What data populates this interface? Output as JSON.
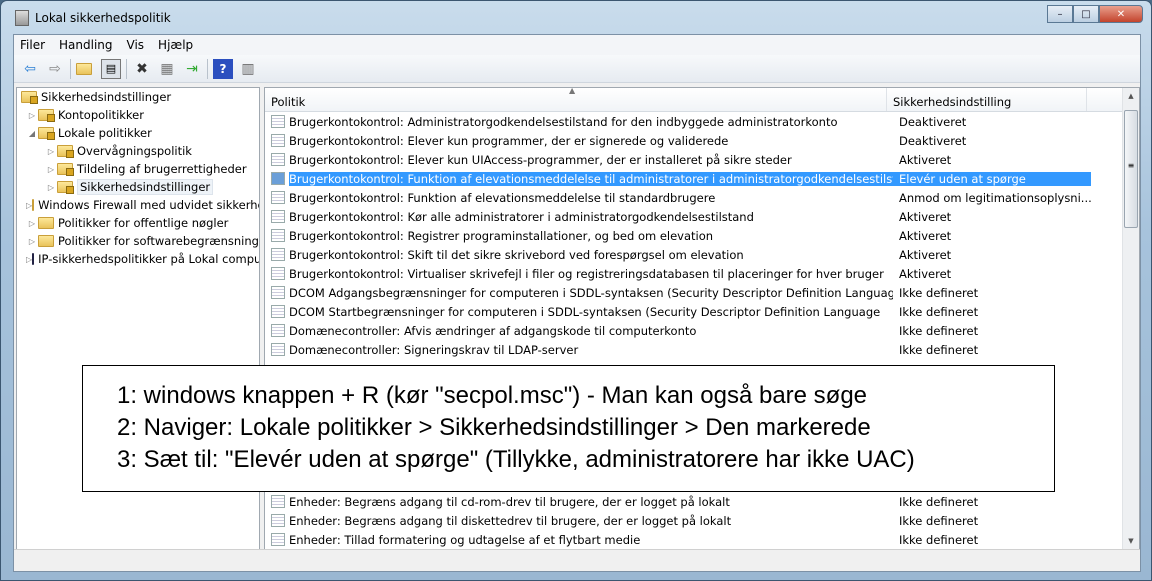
{
  "window": {
    "title": "Lokal sikkerhedspolitik",
    "min": "–",
    "max": "□",
    "close": "✕"
  },
  "menu": [
    "Filer",
    "Handling",
    "Vis",
    "Hjælp"
  ],
  "toolbar": {
    "icons": [
      "back-icon",
      "forward-icon",
      "up-folder-icon",
      "show-hide-tree-icon",
      "delete-icon",
      "properties-icon",
      "export-icon",
      "help-icon",
      "action-pane-icon"
    ]
  },
  "tree": [
    {
      "label": "Sikkerhedsindstillinger",
      "level": 0,
      "expander": ""
    },
    {
      "label": "Kontopolitikker",
      "level": 1,
      "expander": "▷"
    },
    {
      "label": "Lokale politikker",
      "level": 1,
      "expander": "◢"
    },
    {
      "label": "Overvågningspolitik",
      "level": 2,
      "expander": "▷"
    },
    {
      "label": "Tildeling af brugerrettigheder",
      "level": 2,
      "expander": "▷"
    },
    {
      "label": "Sikkerhedsindstillinger",
      "level": 2,
      "expander": "▷"
    },
    {
      "label": "Windows Firewall med udvidet sikkerhed",
      "level": 1,
      "expander": "▷"
    },
    {
      "label": "Politikker for offentlige nøgler",
      "level": 1,
      "expander": "▷"
    },
    {
      "label": "Politikker for softwarebegrænsning",
      "level": 1,
      "expander": "▷"
    },
    {
      "label": "IP-sikkerhedspolitikker på Lokal computer",
      "level": 1,
      "expander": "▷"
    }
  ],
  "list": {
    "columns": [
      "Politik",
      "Sikkerhedsindstilling"
    ],
    "rows_top": [
      [
        "Brugerkontokontrol: Administratorgodkendelsestilstand for den indbyggede administratorkonto",
        "Deaktiveret"
      ],
      [
        "Brugerkontokontrol: Elever kun programmer, der er signerede og validerede",
        "Deaktiveret"
      ],
      [
        "Brugerkontokontrol: Elever kun UIAccess-programmer, der er installeret på sikre steder",
        "Aktiveret"
      ],
      [
        "Brugerkontokontrol: Funktion af elevationsmeddelelse til administratorer i administratorgodkendelsestilstand.",
        "Elevér uden at spørge"
      ],
      [
        "Brugerkontokontrol: Funktion af elevationsmeddelelse til standardbrugere",
        "Anmod om legitimationsoplysni..."
      ],
      [
        "Brugerkontokontrol: Kør alle administratorer i administratorgodkendelsestilstand",
        "Aktiveret"
      ],
      [
        "Brugerkontokontrol: Registrer programinstallationer, og bed om elevation",
        "Aktiveret"
      ],
      [
        "Brugerkontokontrol: Skift til det sikre skrivebord ved forespørgsel om elevation",
        "Aktiveret"
      ],
      [
        "Brugerkontokontrol: Virtualiser skrivefejl i filer og registreringsdatabasen til placeringer for hver bruger",
        "Aktiveret"
      ],
      [
        "DCOM Adgangsbegrænsninger for computeren i SDDL-syntaksen (Security Descriptor Definition Language)",
        "Ikke defineret"
      ],
      [
        "DCOM Startbegrænsninger for computeren i SDDL-syntaksen (Security Descriptor Definition Language",
        "Ikke defineret"
      ],
      [
        "Domænecontroller: Afvis ændringer af adgangskode til computerkonto",
        "Ikke defineret"
      ],
      [
        "Domænecontroller: Signeringskrav til LDAP-server",
        "Ikke defineret"
      ]
    ],
    "rows_bottom": [
      [
        "Enheder: Begræns adgang til cd-rom-drev til brugere, der er logget på lokalt",
        "Ikke defineret"
      ],
      [
        "Enheder: Begræns adgang til diskettedrev til brugere, der er logget på lokalt",
        "Ikke defineret"
      ],
      [
        "Enheder: Tillad formatering og udtagelse af et flytbart medie",
        "Ikke defineret"
      ]
    ],
    "selected_index": 3
  },
  "overlay": [
    "1: windows knappen + R (kør \"secpol.msc\") - Man kan også bare søge",
    "2: Naviger: Lokale politikker > Sikkerhedsindstillinger > Den markerede",
    "3: Sæt til: \"Elevér uden at spørge\" (Tillykke, administratorere har ikke UAC)"
  ]
}
